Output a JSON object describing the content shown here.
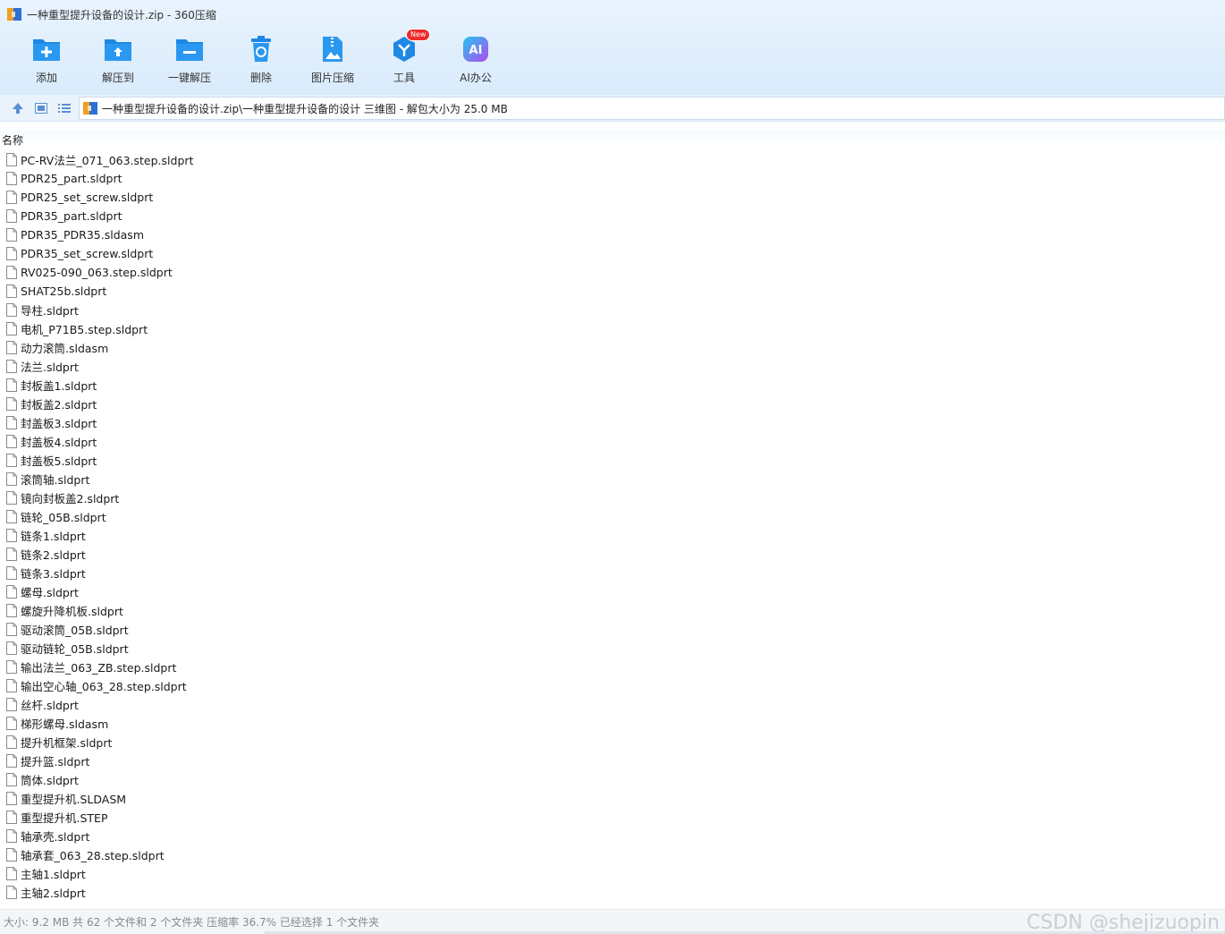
{
  "window": {
    "title": "一种重型提升设备的设计.zip - 360压缩"
  },
  "toolbar": {
    "items": [
      {
        "label": "添加",
        "icon": "folder-add-icon"
      },
      {
        "label": "解压到",
        "icon": "folder-extract-icon"
      },
      {
        "label": "一键解压",
        "icon": "folder-oneclick-icon"
      },
      {
        "label": "删除",
        "icon": "trash-icon"
      },
      {
        "label": "图片压缩",
        "icon": "image-compress-icon"
      },
      {
        "label": "工具",
        "icon": "tools-icon",
        "badge": "New"
      },
      {
        "label": "AI办公",
        "icon": "ai-icon",
        "glyph": "AI"
      }
    ]
  },
  "address": {
    "path": "一种重型提升设备的设计.zip\\一种重型提升设备的设计 三维图 - 解包大小为 25.0 MB"
  },
  "list": {
    "column_name": "名称",
    "files": [
      "PC-RV法兰_071_063.step.sldprt",
      "PDR25_part.sldprt",
      "PDR25_set_screw.sldprt",
      "PDR35_part.sldprt",
      "PDR35_PDR35.sldasm",
      "PDR35_set_screw.sldprt",
      "RV025-090_063.step.sldprt",
      "SHAT25b.sldprt",
      "导柱.sldprt",
      "电机_P71B5.step.sldprt",
      "动力滚筒.sldasm",
      "法兰.sldprt",
      "封板盖1.sldprt",
      "封板盖2.sldprt",
      "封盖板3.sldprt",
      "封盖板4.sldprt",
      "封盖板5.sldprt",
      "滚筒轴.sldprt",
      "镜向封板盖2.sldprt",
      "链轮_05B.sldprt",
      "链条1.sldprt",
      "链条2.sldprt",
      "链条3.sldprt",
      "螺母.sldprt",
      "螺旋升降机板.sldprt",
      "驱动滚筒_05B.sldprt",
      "驱动链轮_05B.sldprt",
      "输出法兰_063_ZB.step.sldprt",
      "输出空心轴_063_28.step.sldprt",
      "丝杆.sldprt",
      "梯形螺母.sldasm",
      "提升机框架.sldprt",
      "提升篮.sldprt",
      "筒体.sldprt",
      "重型提升机.SLDASM",
      "重型提升机.STEP",
      "轴承壳.sldprt",
      "轴承套_063_28.step.sldprt",
      "主轴1.sldprt",
      "主轴2.sldprt"
    ]
  },
  "status": {
    "text": "大小: 9.2 MB 共 62 个文件和 2 个文件夹 压缩率 36.7% 已经选择 1 个文件夹",
    "watermark": "CSDN @shejizuopin"
  },
  "colors": {
    "accent": "#1e88e5",
    "toolbar_bg": "#e3effc",
    "badge": "#ee2a2a"
  }
}
